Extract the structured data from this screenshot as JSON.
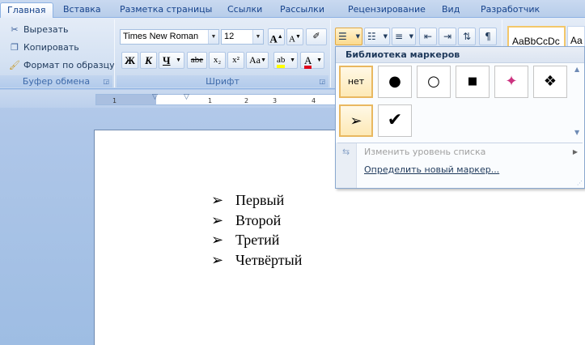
{
  "tabs": [
    "Главная",
    "Вставка",
    "Разметка страницы",
    "Ссылки",
    "Рассылки",
    "Рецензирование",
    "Вид",
    "Разработчик"
  ],
  "clipboard": {
    "cut": "Вырезать",
    "copy": "Копировать",
    "format_painter": "Формат по образцу",
    "group_label": "Буфер обмена"
  },
  "font": {
    "name": "Times New Roman",
    "size": "12",
    "group_label": "Шрифт",
    "grow": "A",
    "shrink": "A",
    "bold": "Ж",
    "italic": "К",
    "underline": "Ч",
    "strike": "abe",
    "subscript": "x₂",
    "superscript": "x²",
    "case": "Aa",
    "highlight": "ab",
    "color": "A"
  },
  "styles": {
    "preview": "AaBbCcDc",
    "next": "Aa"
  },
  "ruler": {
    "ticks": [
      "1",
      "1",
      "2",
      "3",
      "4"
    ]
  },
  "document": {
    "bullet": "➢",
    "items": [
      "Первый",
      "Второй",
      "Третий",
      "Четвёртый"
    ]
  },
  "bullet_library": {
    "title": "Библиотека маркеров",
    "none_label": "нет",
    "bullets": [
      "●",
      "○",
      "■",
      "✦",
      "❖",
      "➢",
      "✔"
    ],
    "change_level": "Изменить уровень списка",
    "define_new": "Определить новый маркер..."
  }
}
